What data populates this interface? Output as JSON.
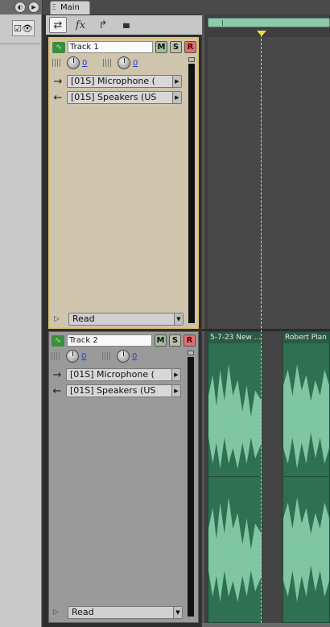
{
  "tab": {
    "label": "Main"
  },
  "toolbar": {
    "items": [
      {
        "icon": "io-routing-icon",
        "glyph": "⇄"
      },
      {
        "icon": "fx-icon",
        "glyph": "fx"
      },
      {
        "icon": "sends-icon",
        "glyph": "↱"
      },
      {
        "icon": "eq-icon",
        "glyph": "▮▮▮"
      }
    ]
  },
  "tracks": [
    {
      "name": "Track 1",
      "mute_label": "M",
      "solo_label": "S",
      "record_label": "R",
      "volume_value": "0",
      "pan_value": "0",
      "input": "[01S] Microphone (",
      "output": "[01S] Speakers (US",
      "automation": "Read"
    },
    {
      "name": "Track 2",
      "mute_label": "M",
      "solo_label": "S",
      "record_label": "R",
      "volume_value": "0",
      "pan_value": "0",
      "input": "[01S] Microphone (",
      "output": "[01S] Speakers (US",
      "automation": "Read"
    }
  ],
  "clips": [
    {
      "title": "5-7-23 New ..."
    },
    {
      "title": "Robert Plan"
    }
  ],
  "colors": {
    "track1_bg": "#cfc5ad",
    "track_selected_border": "#e3c266",
    "clip_bg": "#2f6f52",
    "waveform": "#7fc6a2",
    "playhead": "#e8e44a",
    "record_button": "#e07070"
  }
}
